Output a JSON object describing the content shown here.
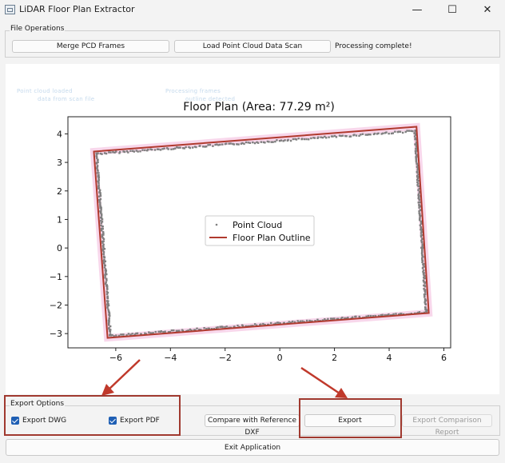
{
  "window": {
    "title": "LiDAR Floor Plan Extractor",
    "controls": {
      "minimize": "—",
      "maximize": "☐",
      "close": "✕"
    }
  },
  "file_operations": {
    "title": "File Operations",
    "merge_button": "Merge PCD Frames",
    "load_button": "Load Point Cloud Data Scan",
    "status": "Processing complete!"
  },
  "ghost_text": [
    "Point cloud loaded",
    "data from scan file",
    "Processing frames",
    "outline detected"
  ],
  "chart_data": {
    "type": "scatter",
    "title": "Floor Plan (Area: 77.29 m²)",
    "xlim": [
      -7.75,
      6.25
    ],
    "ylim": [
      -3.5,
      4.6
    ],
    "x_ticks": [
      "−6",
      "−4",
      "−2",
      "0",
      "2",
      "4",
      "6"
    ],
    "y_ticks": [
      "4",
      "3",
      "2",
      "1",
      "0",
      "−1",
      "−2",
      "−3"
    ],
    "legend": {
      "location": "center",
      "entries": [
        "Point Cloud",
        "Floor Plan Outline"
      ]
    },
    "series": [
      {
        "name": "Floor Plan Outline",
        "kind": "polygon",
        "color": "#b03a2e",
        "x": [
          -6.8,
          5.0,
          5.45,
          -6.3
        ],
        "y": [
          3.38,
          4.25,
          -2.28,
          -3.15
        ]
      },
      {
        "name": "Point Cloud",
        "kind": "points",
        "color": "#7f7f7f",
        "edges": [
          {
            "from": [
              -6.7,
              3.3
            ],
            "to": [
              4.95,
              4.1
            ]
          },
          {
            "from": [
              4.95,
              4.1
            ],
            "to": [
              5.35,
              -2.25
            ]
          },
          {
            "from": [
              5.35,
              -2.25
            ],
            "to": [
              -6.2,
              -3.08
            ]
          },
          {
            "from": [
              -6.2,
              -3.08
            ],
            "to": [
              -6.7,
              3.3
            ]
          }
        ]
      }
    ],
    "grid": false
  },
  "annotations": {
    "color": "#c0392b"
  },
  "export_options": {
    "title": "Export Options",
    "export_dwg_label": "Export DWG",
    "export_dwg_checked": true,
    "export_pdf_label": "Export PDF",
    "export_pdf_checked": true,
    "compare_button": "Compare with Reference DXF",
    "export_button": "Export",
    "export_report_button": "Export Comparison Report"
  },
  "exit_button": "Exit Application"
}
